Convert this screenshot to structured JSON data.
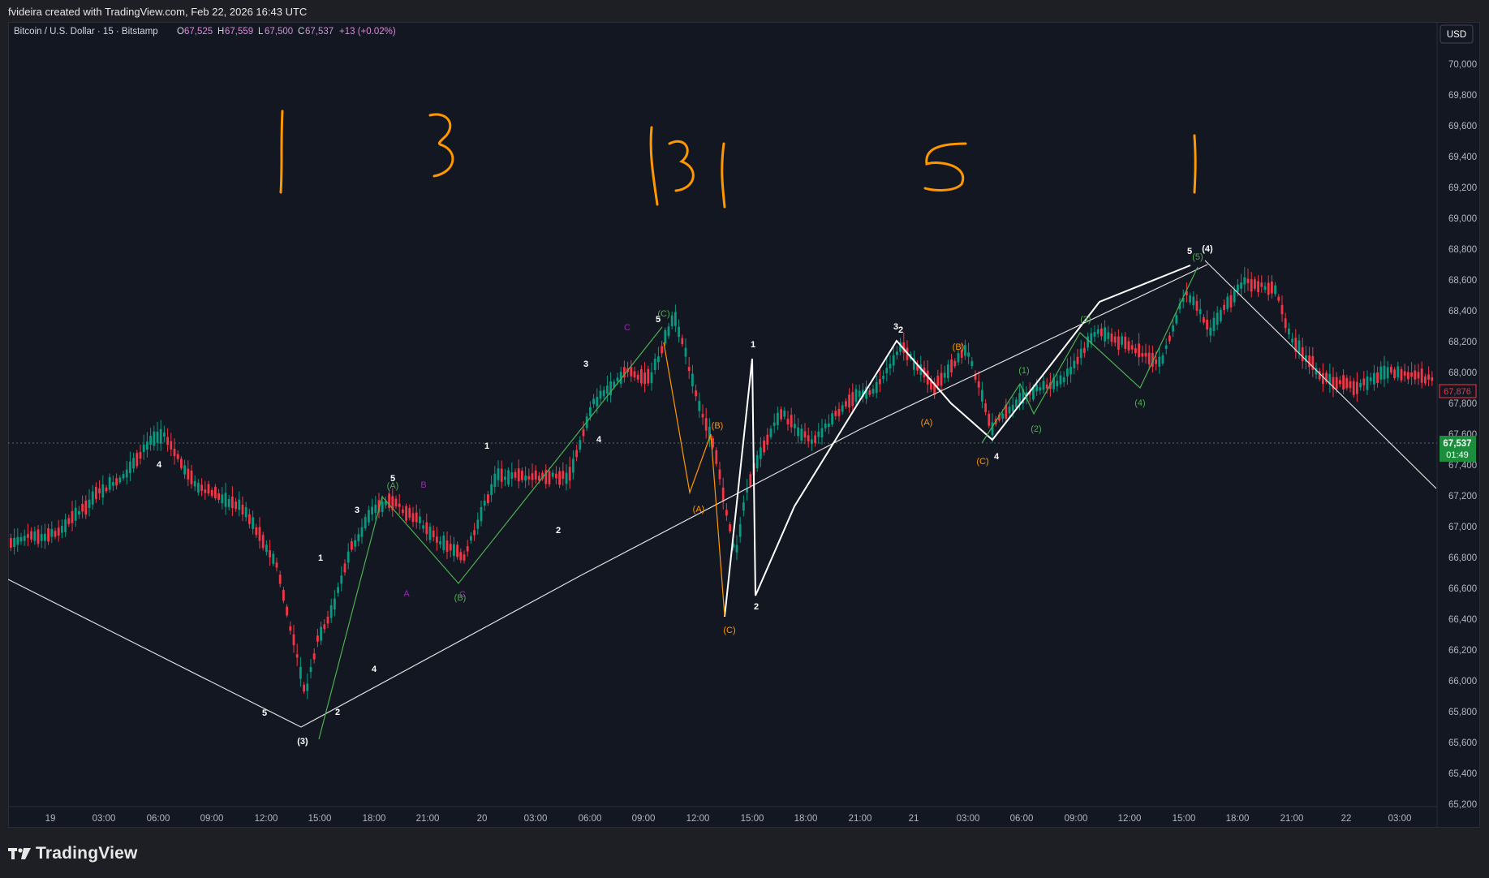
{
  "header": {
    "credit": "fvideira created with TradingView.com, Feb 22, 2026 16:43 UTC"
  },
  "legend": {
    "symbol": "Bitcoin / U.S. Dollar · 15 · Bitstamp",
    "open_label": "O",
    "open": "67,525",
    "high_label": "H",
    "high": "67,559",
    "low_label": "L",
    "low": "67,500",
    "close_label": "C",
    "close": "67,537",
    "change": "+13 (+0.02%)"
  },
  "currency_button": "USD",
  "price_axis": {
    "labels": [
      "70,000",
      "69,800",
      "69,600",
      "69,400",
      "69,200",
      "69,000",
      "68,800",
      "68,600",
      "68,400",
      "68,200",
      "68,000",
      "67,800",
      "67,600",
      "67,400",
      "67,200",
      "67,000",
      "66,800",
      "66,600",
      "66,400",
      "66,200",
      "66,000",
      "65,800",
      "65,600",
      "65,400",
      "65,200"
    ],
    "current_price": "67,537",
    "countdown": "01:49",
    "marker_price": "67,876"
  },
  "time_axis": {
    "labels": [
      "19",
      "03:00",
      "06:00",
      "09:00",
      "12:00",
      "15:00",
      "18:00",
      "21:00",
      "20",
      "03:00",
      "06:00",
      "09:00",
      "12:00",
      "15:00",
      "18:00",
      "21:00",
      "21",
      "03:00",
      "06:00",
      "09:00",
      "12:00",
      "15:00",
      "18:00",
      "21:00",
      "22",
      "03:00"
    ]
  },
  "handwritten_labels": [
    "1",
    "3",
    "131",
    "5",
    "1"
  ],
  "wave_labels": {
    "white": [
      "4",
      "1",
      "3",
      "5",
      "2",
      "4",
      "5",
      "2",
      "1",
      "3",
      "4",
      "2",
      "5",
      "1",
      "2",
      "3",
      "4",
      "5",
      "(3)",
      "(4)"
    ],
    "green": [
      "(A)",
      "(B)",
      "(C)",
      "(1)",
      "(2)",
      "(3)",
      "(4)",
      "(5)"
    ],
    "orange": [
      "(A)",
      "(B)",
      "(C)",
      "(A)",
      "(B)",
      "(C)"
    ],
    "purple": [
      "A",
      "B",
      "C",
      "C"
    ]
  },
  "brand": {
    "name": "TradingView"
  },
  "colors": {
    "background": "#131722",
    "candle_up": "#089981",
    "candle_down": "#f23645",
    "annotation_orange": "#ff9800",
    "wave_green": "#4caf50",
    "wave_purple": "#9c27b0",
    "current_price_bg": "#1b8d3c",
    "marker_price_border": "#f23645"
  }
}
